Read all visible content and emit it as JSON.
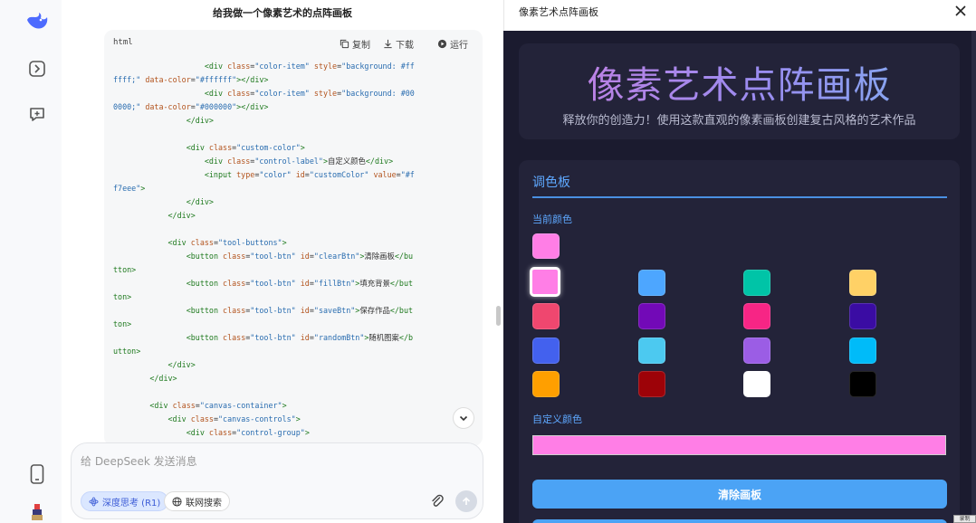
{
  "chat": {
    "title": "给我做一个像素艺术的点阵画板",
    "code": {
      "language": "html",
      "copy_label": "复制",
      "download_label": "下载",
      "run_label": "运行",
      "lines": [
        [
          [
            "",
            "                    "
          ],
          [
            "tg",
            "<div "
          ],
          [
            "at",
            "class"
          ],
          [
            "",
            "="
          ],
          [
            "st",
            "\"color-item\""
          ],
          [
            "",
            " "
          ],
          [
            "at",
            "style"
          ],
          [
            "",
            "="
          ],
          [
            "st",
            "\"background: #ff"
          ]
        ],
        [
          [
            "st",
            "ffff;\""
          ],
          [
            "",
            " "
          ],
          [
            "at",
            "data-color"
          ],
          [
            "",
            "="
          ],
          [
            "st",
            "\"#ffffff\""
          ],
          [
            "tg",
            "></div>"
          ]
        ],
        [
          [
            "",
            "                    "
          ],
          [
            "tg",
            "<div "
          ],
          [
            "at",
            "class"
          ],
          [
            "",
            "="
          ],
          [
            "st",
            "\"color-item\""
          ],
          [
            "",
            " "
          ],
          [
            "at",
            "style"
          ],
          [
            "",
            "="
          ],
          [
            "st",
            "\"background: #00"
          ]
        ],
        [
          [
            "st",
            "0000;\""
          ],
          [
            "",
            " "
          ],
          [
            "at",
            "data-color"
          ],
          [
            "",
            "="
          ],
          [
            "st",
            "\"#000000\""
          ],
          [
            "tg",
            "></div>"
          ]
        ],
        [
          [
            "",
            "                "
          ],
          [
            "tg",
            "</div>"
          ]
        ],
        [
          [
            "",
            ""
          ]
        ],
        [
          [
            "",
            "                "
          ],
          [
            "tg",
            "<div "
          ],
          [
            "at",
            "class"
          ],
          [
            "",
            "="
          ],
          [
            "st",
            "\"custom-color\""
          ],
          [
            "tg",
            ">"
          ]
        ],
        [
          [
            "",
            "                    "
          ],
          [
            "tg",
            "<div "
          ],
          [
            "at",
            "class"
          ],
          [
            "",
            "="
          ],
          [
            "st",
            "\"control-label\""
          ],
          [
            "tg",
            ">"
          ],
          [
            "",
            "自定义颜色"
          ],
          [
            "tg",
            "</div>"
          ]
        ],
        [
          [
            "",
            "                    "
          ],
          [
            "tg",
            "<input "
          ],
          [
            "at",
            "type"
          ],
          [
            "",
            "="
          ],
          [
            "st",
            "\"color\""
          ],
          [
            "",
            " "
          ],
          [
            "at",
            "id"
          ],
          [
            "",
            "="
          ],
          [
            "st",
            "\"customColor\""
          ],
          [
            "",
            " "
          ],
          [
            "at",
            "value"
          ],
          [
            "",
            "="
          ],
          [
            "st",
            "\"#f"
          ]
        ],
        [
          [
            "st",
            "f7eee\""
          ],
          [
            "tg",
            ">"
          ]
        ],
        [
          [
            "",
            "                "
          ],
          [
            "tg",
            "</div>"
          ]
        ],
        [
          [
            "",
            "            "
          ],
          [
            "tg",
            "</div>"
          ]
        ],
        [
          [
            "",
            ""
          ]
        ],
        [
          [
            "",
            "            "
          ],
          [
            "tg",
            "<div "
          ],
          [
            "at",
            "class"
          ],
          [
            "",
            "="
          ],
          [
            "st",
            "\"tool-buttons\""
          ],
          [
            "tg",
            ">"
          ]
        ],
        [
          [
            "",
            "                "
          ],
          [
            "tg",
            "<button "
          ],
          [
            "at",
            "class"
          ],
          [
            "",
            "="
          ],
          [
            "st",
            "\"tool-btn\""
          ],
          [
            "",
            " "
          ],
          [
            "at",
            "id"
          ],
          [
            "",
            "="
          ],
          [
            "st",
            "\"clearBtn\""
          ],
          [
            "tg",
            ">"
          ],
          [
            "",
            "清除画板"
          ],
          [
            "tg",
            "</bu"
          ]
        ],
        [
          [
            "tg",
            "tton>"
          ]
        ],
        [
          [
            "",
            "                "
          ],
          [
            "tg",
            "<button "
          ],
          [
            "at",
            "class"
          ],
          [
            "",
            "="
          ],
          [
            "st",
            "\"tool-btn\""
          ],
          [
            "",
            " "
          ],
          [
            "at",
            "id"
          ],
          [
            "",
            "="
          ],
          [
            "st",
            "\"fillBtn\""
          ],
          [
            "tg",
            ">"
          ],
          [
            "",
            "填充背景"
          ],
          [
            "tg",
            "</but"
          ]
        ],
        [
          [
            "tg",
            "ton>"
          ]
        ],
        [
          [
            "",
            "                "
          ],
          [
            "tg",
            "<button "
          ],
          [
            "at",
            "class"
          ],
          [
            "",
            "="
          ],
          [
            "st",
            "\"tool-btn\""
          ],
          [
            "",
            " "
          ],
          [
            "at",
            "id"
          ],
          [
            "",
            "="
          ],
          [
            "st",
            "\"saveBtn\""
          ],
          [
            "tg",
            ">"
          ],
          [
            "",
            "保存作品"
          ],
          [
            "tg",
            "</but"
          ]
        ],
        [
          [
            "tg",
            "ton>"
          ]
        ],
        [
          [
            "",
            "                "
          ],
          [
            "tg",
            "<button "
          ],
          [
            "at",
            "class"
          ],
          [
            "",
            "="
          ],
          [
            "st",
            "\"tool-btn\""
          ],
          [
            "",
            " "
          ],
          [
            "at",
            "id"
          ],
          [
            "",
            "="
          ],
          [
            "st",
            "\"randomBtn\""
          ],
          [
            "tg",
            ">"
          ],
          [
            "",
            "随机图案"
          ],
          [
            "tg",
            "</b"
          ]
        ],
        [
          [
            "tg",
            "utton>"
          ]
        ],
        [
          [
            "",
            "            "
          ],
          [
            "tg",
            "</div>"
          ]
        ],
        [
          [
            "",
            "        "
          ],
          [
            "tg",
            "</div>"
          ]
        ],
        [
          [
            "",
            ""
          ]
        ],
        [
          [
            "",
            "        "
          ],
          [
            "tg",
            "<div "
          ],
          [
            "at",
            "class"
          ],
          [
            "",
            "="
          ],
          [
            "st",
            "\"canvas-container\""
          ],
          [
            "tg",
            ">"
          ]
        ],
        [
          [
            "",
            "            "
          ],
          [
            "tg",
            "<div "
          ],
          [
            "at",
            "class"
          ],
          [
            "",
            "="
          ],
          [
            "st",
            "\"canvas-controls\""
          ],
          [
            "tg",
            ">"
          ]
        ],
        [
          [
            "",
            "                "
          ],
          [
            "tg",
            "<div "
          ],
          [
            "at",
            "class"
          ],
          [
            "",
            "="
          ],
          [
            "st",
            "\"control-group\""
          ],
          [
            "tg",
            ">"
          ]
        ]
      ]
    },
    "input": {
      "placeholder": "给 DeepSeek 发送消息",
      "deep_think_label": "深度思考 (R1)",
      "web_search_label": "联网搜索"
    }
  },
  "preview": {
    "window_title": "像素艺术点阵画板",
    "app_title": "像素艺术点阵画板",
    "app_subtitle": "释放你的创造力！使用这款直观的像素画板创建复古风格的艺术作品",
    "palette": {
      "heading": "调色板",
      "current_label": "当前颜色",
      "current_color": "#ff7ee6",
      "custom_label": "自定义颜色",
      "custom_value": "#ff7ee6",
      "colors": [
        "#ff7ee6",
        "#4da6ff",
        "#00c4a7",
        "#ffd166",
        "#ef476f",
        "#7209b7",
        "#f72585",
        "#3a0ca3",
        "#4361ee",
        "#4cc9f0",
        "#9b5de5",
        "#00bbf9",
        "#ff9f00",
        "#9d0208",
        "#ffffff",
        "#000000"
      ],
      "selected_index": 0,
      "clear_button": "清除画板"
    },
    "corner_tag": "录制"
  },
  "colors": {
    "accent": "#4ba3f5",
    "preview_bg": "#1b1b2f",
    "card_bg": "#232339"
  }
}
